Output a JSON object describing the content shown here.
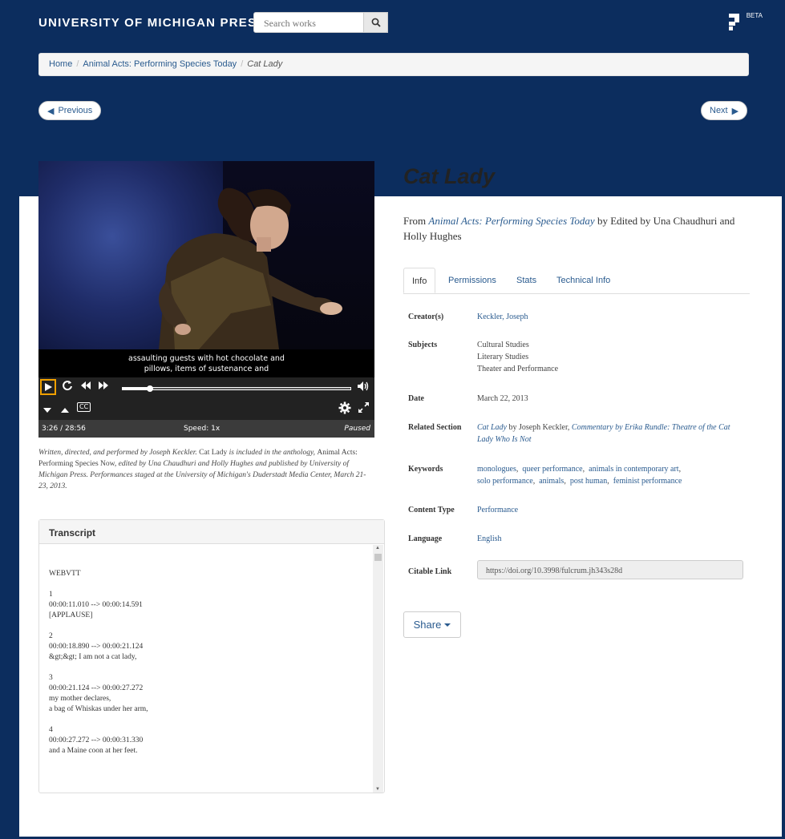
{
  "header": {
    "brand": "UNIVERSITY OF MICHIGAN PRESS",
    "search_placeholder": "Search works",
    "logo_badge": "BETA"
  },
  "breadcrumb": {
    "home": "Home",
    "parent": "Animal Acts: Performing Species Today",
    "current": "Cat Lady"
  },
  "pager": {
    "previous": "Previous",
    "next": "Next"
  },
  "video": {
    "caption_line1": "assaulting guests with hot chocolate and",
    "caption_line2": "pillows, items of sustenance and",
    "time": "3:26 / 28:56",
    "speed": "Speed: 1x",
    "state": "Paused",
    "progress_fraction": 0.12,
    "cc_label": "CC"
  },
  "description": {
    "p1": "Written, directed, and performed by Joseph Keckler.",
    "p2": "Cat Lady",
    "p3": "is included in the anthology,",
    "p4": "Animal Acts: Performing Species Now,",
    "p5": "edited by Una Chaudhuri and Holly Hughes and published by University of Michigan Press. Performances staged at the University of Michigan's Duderstadt Media Center, March 21-23, 2013."
  },
  "transcript": {
    "title": "Transcript",
    "text": "WEBVTT\n\n1\n00:00:11.010 --> 00:00:14.591\n[APPLAUSE]\n\n2\n00:00:18.890 --> 00:00:21.124\n&gt;&gt; I am not a cat lady,\n\n3\n00:00:21.124 --> 00:00:27.272\nmy mother declares,\na bag of Whiskas under her arm,\n\n4\n00:00:27.272 --> 00:00:31.330\nand a Maine coon at her feet."
  },
  "work": {
    "title": "Cat Lady",
    "from_label": "From",
    "book": "Animal Acts: Performing Species Today",
    "by_text": "by Edited by Una Chaudhuri and Holly Hughes"
  },
  "tabs": [
    "Info",
    "Permissions",
    "Stats",
    "Technical Info"
  ],
  "info": {
    "creator_k": "Creator(s)",
    "creator_v": "Keckler, Joseph",
    "subjects_k": "Subjects",
    "subjects": [
      "Cultural Studies",
      "Literary Studies",
      "Theater and Performance"
    ],
    "date_k": "Date",
    "date_v": "March 22, 2013",
    "related_k": "Related Section",
    "related_a": "Cat Lady",
    "related_b": "by Joseph Keckler,",
    "related_c": "Commentary by Erika Rundle: Theatre of the Cat Lady Who Is Not",
    "keywords_k": "Keywords",
    "keywords": [
      "monologues",
      "queer performance",
      "animals in contemporary art",
      "solo performance",
      "animals",
      "post human",
      "feminist performance"
    ],
    "content_k": "Content Type",
    "content_v": "Performance",
    "language_k": "Language",
    "language_v": "English",
    "cite_k": "Citable Link",
    "cite_v": "https://doi.org/10.3998/fulcrum.jh343s28d"
  },
  "share_label": "Share",
  "colors": {
    "navy": "#0c2d5e",
    "link": "#2a5b8f",
    "focus": "#f0a000"
  }
}
